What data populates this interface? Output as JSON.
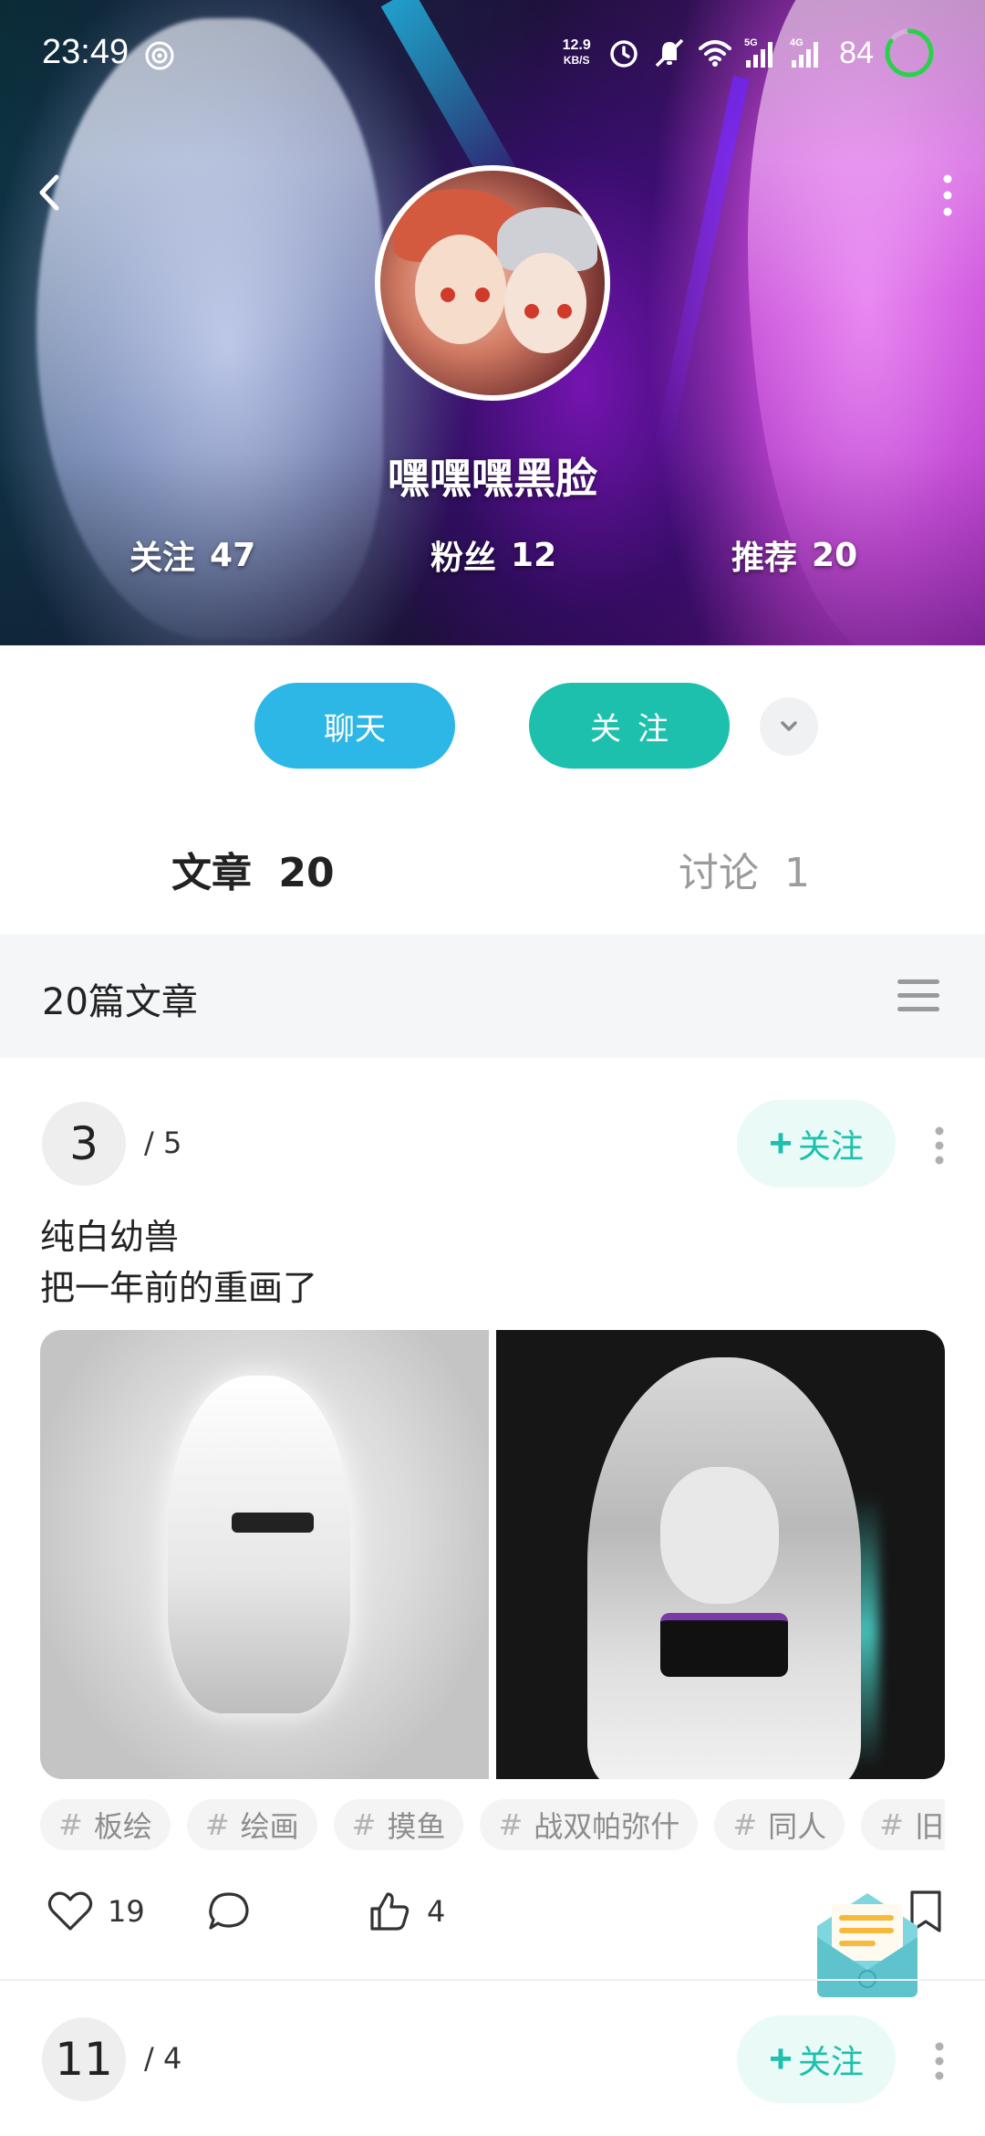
{
  "status_bar": {
    "time": "23:49",
    "net_speed_value": "12.9",
    "net_speed_unit": "KB/S",
    "battery": "84",
    "icons": [
      "nfc-icon",
      "alarm-icon",
      "mute-icon",
      "wifi-icon",
      "signal-5g-icon",
      "signal-4g-icon",
      "battery-ring-icon"
    ]
  },
  "profile": {
    "username": "嘿嘿嘿黑脸",
    "stats": [
      {
        "label": "关注",
        "value": "47"
      },
      {
        "label": "粉丝",
        "value": "12"
      },
      {
        "label": "推荐",
        "value": "20"
      }
    ]
  },
  "actions": {
    "chat_label": "聊天",
    "follow_label": "关注"
  },
  "tabs": [
    {
      "label": "文章",
      "count": "20",
      "active": true
    },
    {
      "label": "讨论",
      "count": "1",
      "active": false
    }
  ],
  "section": {
    "title": "20篇文章"
  },
  "posts": [
    {
      "page": "3",
      "total": "/ 5",
      "follow_label": "关注",
      "text_line1": "纯白幼兽",
      "text_line2": "把一年前的重画了",
      "tags": [
        "板绘",
        "绘画",
        "摸鱼",
        "战双帕弥什",
        "同人",
        "旧图"
      ],
      "likes": "19",
      "thumbs": "4"
    },
    {
      "page": "11",
      "total": "/ 4",
      "follow_label": "关注"
    }
  ],
  "colors": {
    "chat_button": "#2db7e6",
    "follow_button": "#1cc0ad",
    "follow_small_bg": "#e9faf7",
    "section_bg": "#f5f6f7"
  }
}
